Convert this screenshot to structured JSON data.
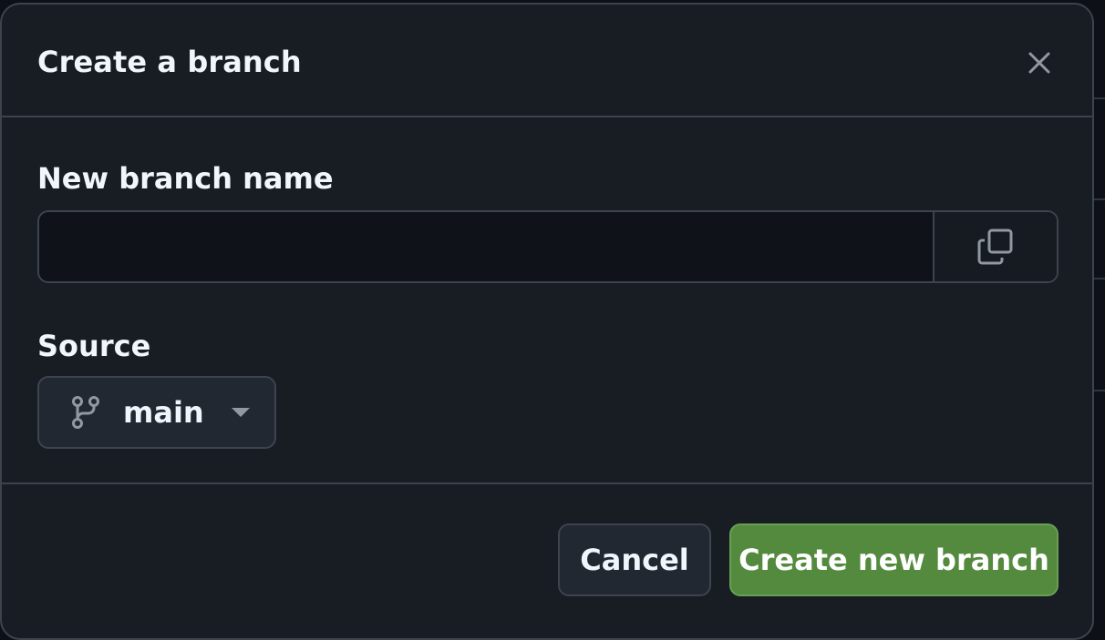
{
  "dialog": {
    "title": "Create a branch",
    "close_icon": "close-icon"
  },
  "branch_name": {
    "label": "New branch name",
    "value": "",
    "placeholder": "",
    "copy_icon": "copy-icon"
  },
  "source": {
    "label": "Source",
    "selected_branch": "main",
    "branch_icon": "git-branch-icon",
    "dropdown_icon": "caret-down-icon"
  },
  "footer": {
    "cancel_label": "Cancel",
    "create_label": "Create new branch"
  },
  "colors": {
    "dialog_bg": "#181c23",
    "border": "#3d444d",
    "text": "#f0f6fc",
    "primary_button": "#548a3e"
  }
}
